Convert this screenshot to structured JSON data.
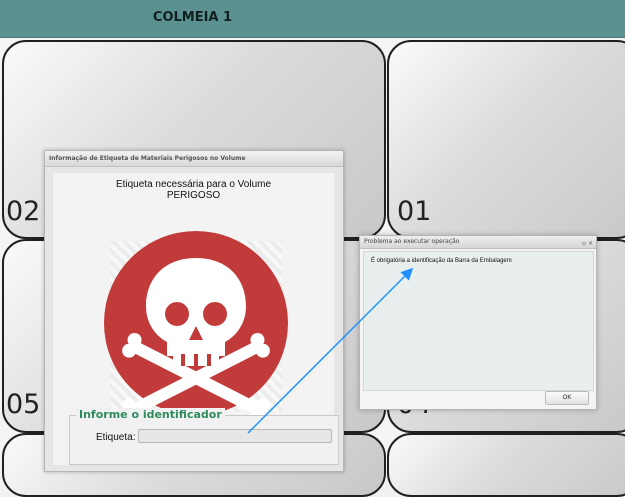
{
  "header": {
    "title": "COLMEIA 1"
  },
  "slots": [
    {
      "number": "02"
    },
    {
      "number": "01"
    },
    {
      "number": "05"
    },
    {
      "number": "04"
    }
  ],
  "hazard_dialog": {
    "title": "Informação de Etiqueta de Materiais Perigosos no Volume",
    "message_line1": "Etiqueta necessária para o Volume",
    "message_line2": "PERIGOSO",
    "group_legend": "Informe o identificador",
    "field_label": "Etiqueta:",
    "field_value": "",
    "icon": "skull-crossbones-icon",
    "icon_color": "#c23b3b"
  },
  "error_dialog": {
    "title": "Problema ao executar operação",
    "message": "É obrigatória a identificação da Barra da Embalagem",
    "ok_label": "OK",
    "window_buttons": "▫ ×"
  },
  "colors": {
    "header": "#5c9191",
    "legend": "#2e8b5e",
    "arrow": "#1e90ff"
  }
}
